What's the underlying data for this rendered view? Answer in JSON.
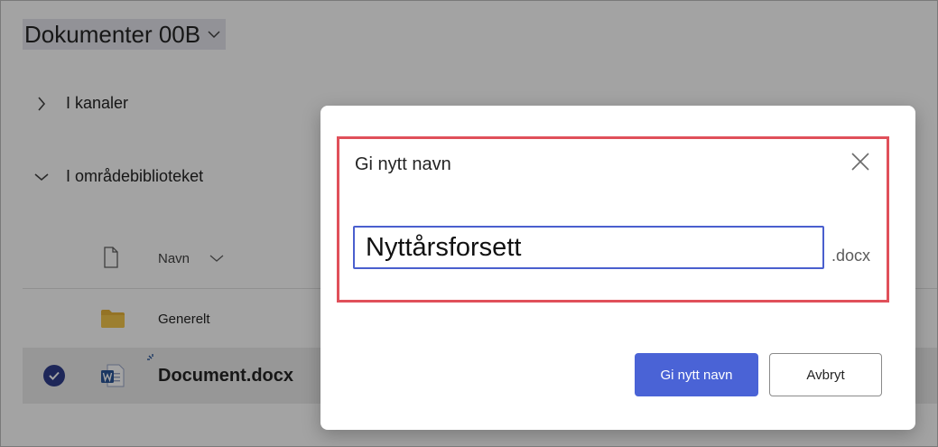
{
  "library": {
    "title": "Dokumenter 00B",
    "sections": {
      "channels": "I kanaler",
      "site_library": "I områdebiblioteket"
    },
    "column_header": "Navn",
    "rows": [
      {
        "name": "Generelt",
        "type": "folder"
      },
      {
        "name": "Document.docx",
        "type": "word-document",
        "selected": true
      }
    ]
  },
  "dialog": {
    "title": "Gi nytt navn",
    "input_value": "Nyttårsforsett",
    "extension": ".docx",
    "confirm_label": "Gi nytt navn",
    "cancel_label": "Avbryt"
  },
  "colors": {
    "accent": "#4a63d6",
    "highlight_border": "#e0505a",
    "folder": "#e8b53a",
    "word": "#2b579a"
  }
}
